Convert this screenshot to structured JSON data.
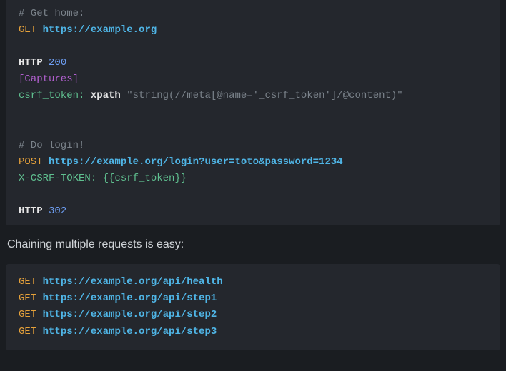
{
  "block1": {
    "c1": "# Get home:",
    "m1": "GET",
    "u1": "https://example.org",
    "kw_http1": "HTTP",
    "code1": "200",
    "section": "[Captures]",
    "cap_name": "csrf_token",
    "colon1": ":",
    "cap_query": "xpath",
    "cap_str": "\"string(//meta[@name='_csrf_token']/@content)\"",
    "c2": "# Do login!",
    "m2": "POST",
    "u2": "https://example.org/login?user=toto&password=1234",
    "hdr": "X-CSRF-TOKEN:",
    "var": "{{csrf_token}}",
    "kw_http2": "HTTP",
    "code2": "302"
  },
  "prose": {
    "text": "Chaining multiple requests is easy:"
  },
  "block2": {
    "m": "GET",
    "u1": "https://example.org/api/health",
    "u2": "https://example.org/api/step1",
    "u3": "https://example.org/api/step2",
    "u4": "https://example.org/api/step3"
  }
}
